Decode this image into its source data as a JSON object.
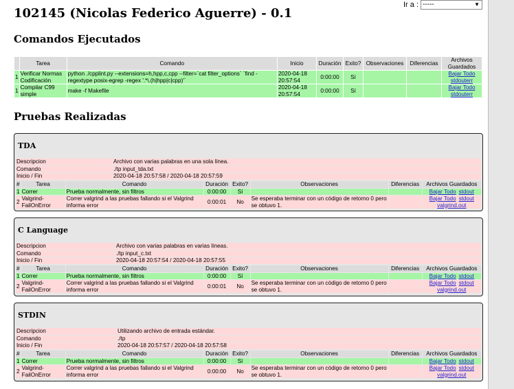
{
  "goto": {
    "label": "Ir a :",
    "selected": "-----"
  },
  "title": "102145 (Nicolas Federico Aguerre) - 0.1",
  "commands_heading": "Comandos Ejecutados",
  "commands_table": {
    "headers": [
      "Tarea",
      "Comando",
      "Inicio",
      "Duración",
      "Exito?",
      "Observaciones",
      "Diferencias",
      "Archivos Guardados"
    ],
    "rows": [
      {
        "n": "1",
        "tarea": "Verificar Normas Codificación",
        "comando": "python ./cpplint.py --extensions=h,hpp,c,cpp --filter=`cat filter_options` `find -regextype posix-egrep -regex '.*\\.(h|hpp|c|cpp)'`",
        "inicio": "2020-04-18 20:57:54",
        "duracion": "0:00:00",
        "exito": "Sí",
        "obs": "",
        "dif": "",
        "links": [
          "Bajar Todo",
          "stdouterr"
        ]
      },
      {
        "n": "1",
        "tarea": "Compilar C99 simple",
        "comando": "make -f Makefile",
        "inicio": "2020-04-18 20:57:54",
        "duracion": "0:00:00",
        "exito": "Sí",
        "obs": "",
        "dif": "",
        "links": [
          "Bajar Todo",
          "stdouterr"
        ]
      }
    ]
  },
  "tests_heading": "Pruebas Realizadas",
  "run_headers": [
    "#",
    "Tarea",
    "Comando",
    "Duración",
    "Exito?",
    "Observaciones",
    "Diferencias",
    "Archivos Guardados"
  ],
  "info_labels": {
    "desc": "Descripcion",
    "cmd": "Comando",
    "time": "Inicio / Fin"
  },
  "sections": [
    {
      "name": "TDA",
      "desc": "Archivo con varias palabras en una sola línea.",
      "cmd": "./tp input_tda.txt",
      "time": "2020-04-18 20:57:58 / 2020-04-18 20:57:59",
      "runs": [
        {
          "n": "1",
          "tarea": "Correr",
          "comando": "Prueba normalmente, sin filtros",
          "dur": "0:00:00",
          "exito": "Sí",
          "obs": "",
          "dif": "",
          "links": [
            "Bajar Todo",
            "stdout"
          ],
          "ok": true
        },
        {
          "n": "2",
          "tarea": "Valgrind-FailOnError",
          "comando": "Correr valgrind a las pruebas fallando si el Valgrind informa error",
          "dur": "0:00:01",
          "exito": "No",
          "obs": "Se esperaba terminar con un código de retorno 0 pero se obtuvo 1.",
          "dif": "",
          "links": [
            "Bajar Todo",
            "stdout",
            "valgrind.out"
          ],
          "ok": false
        }
      ]
    },
    {
      "name": "C Language",
      "desc": "Archivo con varias palabras en varias líneas.",
      "cmd": "./tp input_c.txt",
      "time": "2020-04-18 20:57:54 / 2020-04-18 20:57:55",
      "runs": [
        {
          "n": "1",
          "tarea": "Correr",
          "comando": "Prueba normalmente, sin filtros",
          "dur": "0:00:00",
          "exito": "Sí",
          "obs": "",
          "dif": "",
          "links": [
            "Bajar Todo",
            "stdout"
          ],
          "ok": true
        },
        {
          "n": "2",
          "tarea": "Valgrind-FailOnError",
          "comando": "Correr valgrind a las pruebas fallando si el Valgrind informa error",
          "dur": "0:00:01",
          "exito": "No",
          "obs": "Se esperaba terminar con un código de retorno 0 pero se obtuvo 1.",
          "dif": "",
          "links": [
            "Bajar Todo",
            "stdout",
            "valgrind.out"
          ],
          "ok": false
        }
      ]
    },
    {
      "name": "STDIN",
      "desc": "Utilizando archivo de entrada estándar.",
      "cmd": "./tp",
      "time": "2020-04-18 20:57:57 / 2020-04-18 20:57:58",
      "runs": [
        {
          "n": "1",
          "tarea": "Correr",
          "comando": "Prueba normalmente, sin filtros",
          "dur": "0:00:00",
          "exito": "Sí",
          "obs": "",
          "dif": "",
          "links": [
            "Bajar Todo",
            "stdout"
          ],
          "ok": true
        },
        {
          "n": "2",
          "tarea": "Valgrind-FailOnError",
          "comando": "Correr valgrind a las pruebas fallando si el Valgrind informa error",
          "dur": "0:00:00",
          "exito": "No",
          "obs": "Se esperaba terminar con un código de retorno 0 pero se obtuvo 1.",
          "dif": "",
          "links": [
            "Bajar Todo",
            "stdout",
            "valgrind.out"
          ],
          "ok": false
        }
      ]
    }
  ]
}
